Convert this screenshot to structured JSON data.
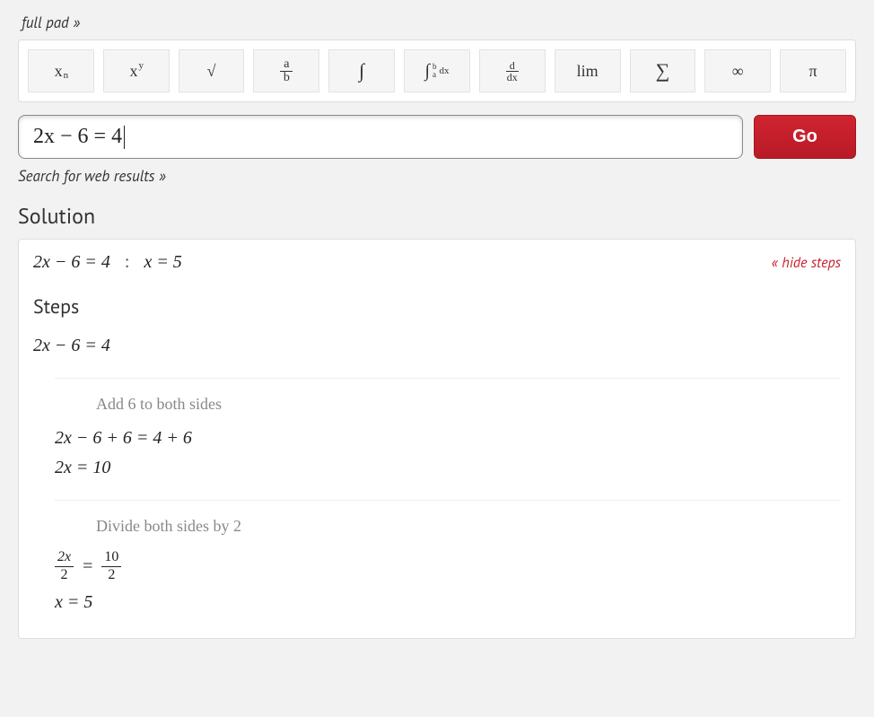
{
  "links": {
    "full_pad": "full pad »",
    "web_results": "Search for web results »",
    "hide_steps": "« hide steps"
  },
  "pad": {
    "subscript": "x",
    "subscript_n": "n",
    "superscript": "x",
    "superscript_y": "y",
    "sqrt": "√",
    "frac_a": "a",
    "frac_b": "b",
    "integral": "∫",
    "defint_sym": "∫",
    "defint_a": "a",
    "defint_b": "b",
    "defint_dx": "dx",
    "deriv_d": "d",
    "deriv_dx": "dx",
    "lim": "lim",
    "sum": "∑",
    "infinity": "∞",
    "pi": "π"
  },
  "input": {
    "value": "2x − 6 = 4",
    "go_label": "Go"
  },
  "headings": {
    "solution": "Solution",
    "steps": "Steps"
  },
  "solution": {
    "problem": "2x − 6 = 4",
    "colon": ":",
    "answer": "x = 5"
  },
  "steps": {
    "initial": "2x − 6 = 4",
    "block1": {
      "explain": "Add 6 to both sides",
      "line1": "2x − 6 + 6 = 4 + 6",
      "line2": "2x = 10"
    },
    "block2": {
      "explain": "Divide both sides by 2",
      "frac_l_num": "2x",
      "frac_l_den": "2",
      "eq": "=",
      "frac_r_num": "10",
      "frac_r_den": "2",
      "line2": "x = 5"
    }
  }
}
